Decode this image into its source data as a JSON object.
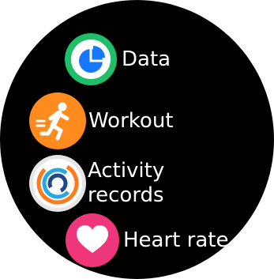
{
  "menu": {
    "items": [
      {
        "label": "Data",
        "icon": "pie-chart-icon",
        "color": "#1fbf6a"
      },
      {
        "label": "Workout",
        "icon": "running-person-icon",
        "color": "#ff8a1e"
      },
      {
        "label": "Activity records",
        "icon": "activity-rings-icon",
        "color": "#e0e0e0"
      },
      {
        "label": "Heart rate",
        "icon": "heart-icon",
        "color": "#f0367a"
      }
    ]
  }
}
